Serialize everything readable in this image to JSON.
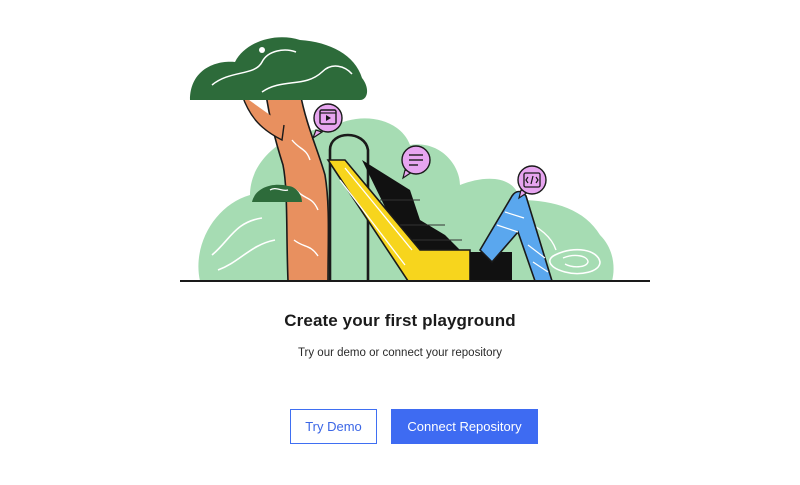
{
  "empty_state": {
    "title": "Create your first playground",
    "subtitle": "Try our demo or connect your repository"
  },
  "actions": {
    "try_demo_label": "Try Demo",
    "connect_repo_label": "Connect Repository"
  },
  "illustration": {
    "icons": [
      "play-video-icon",
      "text-lines-icon",
      "code-brackets-icon"
    ]
  },
  "colors": {
    "accent": "#3e6bf2",
    "tree_canopy": "#2d6b3a",
    "tree_trunk": "#e8905f",
    "bush": "#a6dcb3",
    "slide": "#f7d51d",
    "blue_shape": "#5aa7ee",
    "bubble": "#e7a5f0"
  }
}
